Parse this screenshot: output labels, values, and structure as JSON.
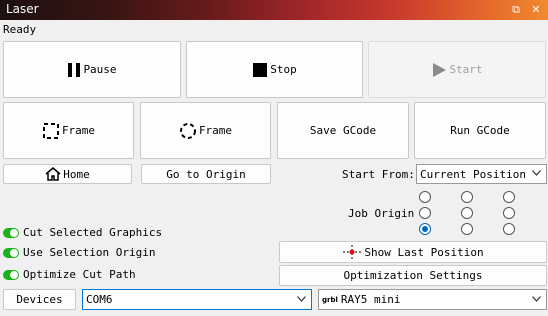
{
  "window": {
    "title": "Laser",
    "restore_glyph": "⧉",
    "close_glyph": "✕"
  },
  "status": "Ready",
  "buttons": {
    "pause": "Pause",
    "stop": "Stop",
    "start": "Start",
    "frame_rect": "Frame",
    "frame_circle": "Frame",
    "save_gcode": "Save GCode",
    "run_gcode": "Run GCode",
    "home": "Home",
    "go_to_origin": "Go to Origin",
    "show_last_position": "Show Last Position",
    "optimization_settings": "Optimization Settings",
    "devices": "Devices"
  },
  "start_from": {
    "label": "Start From:",
    "value": "Current Position"
  },
  "job_origin": {
    "label": "Job Origin",
    "selected_index": 6
  },
  "toggles": [
    {
      "label": "Cut Selected Graphics",
      "on": true
    },
    {
      "label": "Use Selection Origin",
      "on": true
    },
    {
      "label": "Optimize Cut Path",
      "on": true
    }
  ],
  "port": {
    "value": "COM6"
  },
  "device": {
    "prefix": "grbl",
    "value": "RAY5 mini"
  },
  "colors": {
    "toggle_on": "#18b318",
    "radio_selected": "#0067c0",
    "focus_border": "#0078d7"
  }
}
